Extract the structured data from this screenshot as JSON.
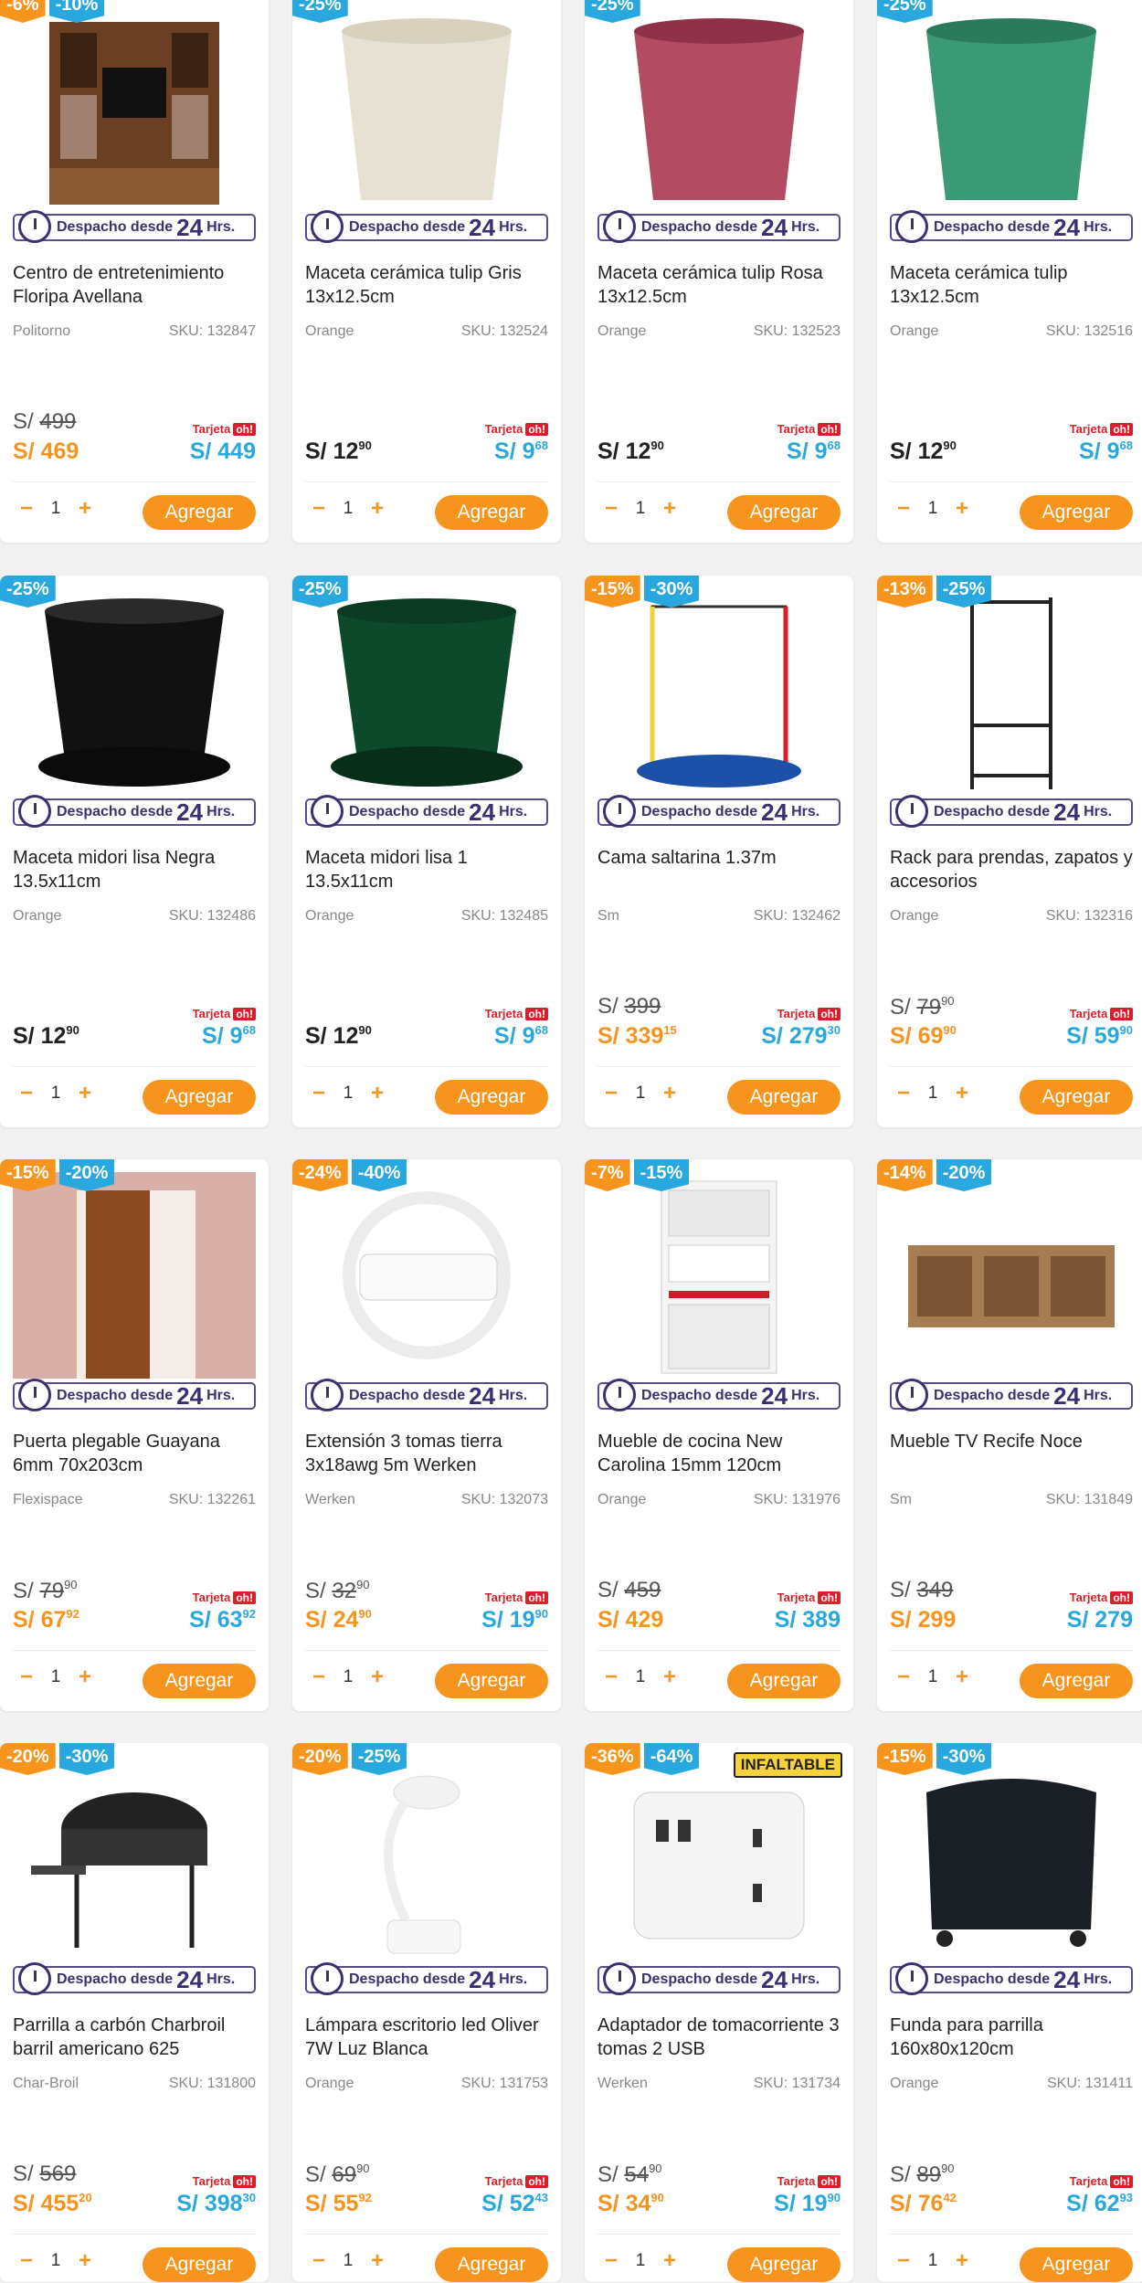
{
  "shipping": {
    "prefix": "Despacho desde",
    "num": "24",
    "suffix": "Hrs."
  },
  "tarjeta_label": "Tarjeta",
  "oh_label": "oh!",
  "currency": "S/",
  "add_label": "Agregar",
  "qty_default": "1",
  "minus": "−",
  "plus": "+",
  "colors": {
    "orange": "#f7941d",
    "blue": "#29a8e0",
    "purple": "#3d2f72",
    "red": "#d9202a"
  },
  "products": [
    {
      "b1": "-6%",
      "b2": "-10%",
      "img": "tv-unit",
      "title": "Centro de entretenimiento Floripa Avellana",
      "brand": "Politorno",
      "sku": "SKU: 132847",
      "old_int": "499",
      "old_dec": "",
      "price_int": "469",
      "price_dec": "",
      "card_int": "449",
      "card_dec": "",
      "has_old": true
    },
    {
      "b1": "",
      "b2": "-25%",
      "img": "pot-beige",
      "title": "Maceta cerámica tulip Gris 13x12.5cm",
      "brand": "Orange",
      "sku": "SKU: 132524",
      "old_int": "",
      "old_dec": "",
      "price_int": "12",
      "price_dec": "90",
      "card_int": "9",
      "card_dec": "68",
      "has_old": false
    },
    {
      "b1": "",
      "b2": "-25%",
      "img": "pot-pink",
      "title": "Maceta cerámica tulip Rosa 13x12.5cm",
      "brand": "Orange",
      "sku": "SKU: 132523",
      "old_int": "",
      "old_dec": "",
      "price_int": "12",
      "price_dec": "90",
      "card_int": "9",
      "card_dec": "68",
      "has_old": false
    },
    {
      "b1": "",
      "b2": "-25%",
      "img": "pot-green",
      "title": "Maceta cerámica tulip 13x12.5cm",
      "brand": "Orange",
      "sku": "SKU: 132516",
      "old_int": "",
      "old_dec": "",
      "price_int": "12",
      "price_dec": "90",
      "card_int": "9",
      "card_dec": "68",
      "has_old": false
    },
    {
      "b1": "",
      "b2": "-25%",
      "img": "pot-black",
      "title": "Maceta midori lisa Negra 13.5x11cm",
      "brand": "Orange",
      "sku": "SKU: 132486",
      "old_int": "",
      "old_dec": "",
      "price_int": "12",
      "price_dec": "90",
      "card_int": "9",
      "card_dec": "68",
      "has_old": false
    },
    {
      "b1": "",
      "b2": "-25%",
      "img": "pot-darkgreen",
      "title": "Maceta midori lisa 1 13.5x11cm",
      "brand": "Orange",
      "sku": "SKU: 132485",
      "old_int": "",
      "old_dec": "",
      "price_int": "12",
      "price_dec": "90",
      "card_int": "9",
      "card_dec": "68",
      "has_old": false
    },
    {
      "b1": "-15%",
      "b2": "-30%",
      "img": "trampoline",
      "title": "Cama saltarina 1.37m",
      "brand": "Sm",
      "sku": "SKU: 132462",
      "old_int": "399",
      "old_dec": "",
      "price_int": "339",
      "price_dec": "15",
      "card_int": "279",
      "card_dec": "30",
      "has_old": true
    },
    {
      "b1": "-13%",
      "b2": "-25%",
      "img": "rack",
      "title": "Rack para prendas, zapatos y accesorios",
      "brand": "Orange",
      "sku": "SKU: 132316",
      "old_int": "79",
      "old_dec": "90",
      "price_int": "69",
      "price_dec": "90",
      "card_int": "59",
      "card_dec": "90",
      "has_old": true
    },
    {
      "b1": "-15%",
      "b2": "-20%",
      "img": "door",
      "title": "Puerta plegable Guayana 6mm 70x203cm",
      "brand": "Flexispace",
      "sku": "SKU: 132261",
      "old_int": "79",
      "old_dec": "90",
      "price_int": "67",
      "price_dec": "92",
      "card_int": "63",
      "card_dec": "92",
      "has_old": true
    },
    {
      "b1": "-24%",
      "b2": "-40%",
      "img": "extension",
      "title": "Extensión 3 tomas tierra 3x18awg 5m Werken",
      "brand": "Werken",
      "sku": "SKU: 132073",
      "old_int": "32",
      "old_dec": "90",
      "price_int": "24",
      "price_dec": "90",
      "card_int": "19",
      "card_dec": "90",
      "has_old": true
    },
    {
      "b1": "-7%",
      "b2": "-15%",
      "img": "kitchen",
      "title": "Mueble de cocina New Carolina 15mm 120cm",
      "brand": "Orange",
      "sku": "SKU: 131976",
      "old_int": "459",
      "old_dec": "",
      "price_int": "429",
      "price_dec": "",
      "card_int": "389",
      "card_dec": "",
      "has_old": true
    },
    {
      "b1": "-14%",
      "b2": "-20%",
      "img": "tv-stand",
      "title": "Mueble TV Recife Noce",
      "brand": "Sm",
      "sku": "SKU: 131849",
      "old_int": "349",
      "old_dec": "",
      "price_int": "299",
      "price_dec": "",
      "card_int": "279",
      "card_dec": "",
      "has_old": true
    },
    {
      "b1": "-20%",
      "b2": "-30%",
      "img": "grill",
      "title": "Parrilla a carbón Charbroil barril americano 625",
      "brand": "Char-Broil",
      "sku": "SKU: 131800",
      "old_int": "569",
      "old_dec": "",
      "price_int": "455",
      "price_dec": "20",
      "card_int": "398",
      "card_dec": "30",
      "has_old": true
    },
    {
      "b1": "-20%",
      "b2": "-25%",
      "img": "lamp",
      "title": "Lámpara escritorio led Oliver 7W Luz Blanca",
      "brand": "Orange",
      "sku": "SKU: 131753",
      "old_int": "69",
      "old_dec": "90",
      "price_int": "55",
      "price_dec": "92",
      "card_int": "52",
      "card_dec": "43",
      "has_old": true
    },
    {
      "b1": "-36%",
      "b2": "-64%",
      "img": "adapter",
      "inflate": "INFALTABLE",
      "title": "Adaptador de tomacorriente 3 tomas 2 USB",
      "brand": "Werken",
      "sku": "SKU: 131734",
      "old_int": "54",
      "old_dec": "90",
      "price_int": "34",
      "price_dec": "90",
      "card_int": "19",
      "card_dec": "90",
      "has_old": true
    },
    {
      "b1": "-15%",
      "b2": "-30%",
      "img": "cover",
      "title": "Funda para parrilla 160x80x120cm",
      "brand": "Orange",
      "sku": "SKU: 131411",
      "old_int": "89",
      "old_dec": "90",
      "price_int": "76",
      "price_dec": "42",
      "card_int": "62",
      "card_dec": "93",
      "has_old": true
    }
  ]
}
